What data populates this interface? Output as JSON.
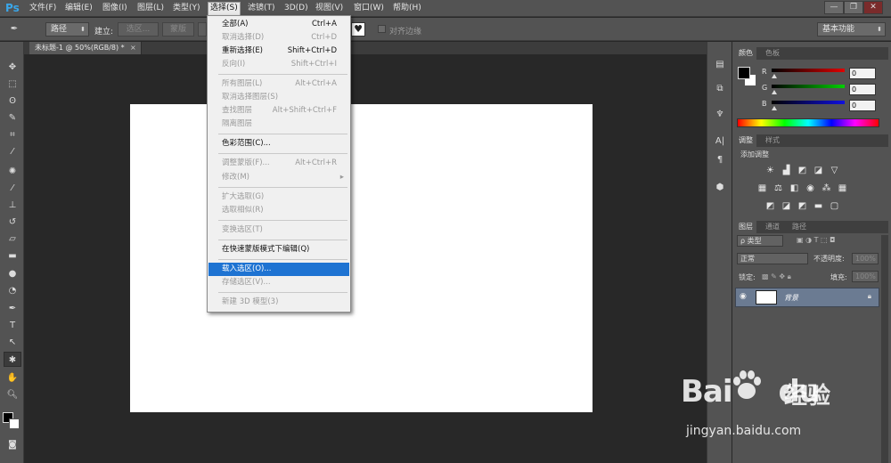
{
  "app": {
    "logo": "Ps"
  },
  "menubar": {
    "items": [
      "文件(F)",
      "编辑(E)",
      "图像(I)",
      "图层(L)",
      "类型(Y)",
      "选择(S)",
      "滤镜(T)",
      "3D(D)",
      "视图(V)",
      "窗口(W)",
      "帮助(H)"
    ],
    "active": "选择(S)"
  },
  "window_buttons": [
    "—",
    "❐",
    "✕"
  ],
  "options": {
    "path_label": "路径",
    "build_label": "建立:",
    "selection_btn": "选区...",
    "mask_btn": "蒙版",
    "align_edges": "对齐边缘",
    "workspace": "基本功能"
  },
  "document_tab": {
    "title": "未标题-1 @ 50%(RGB/8) *",
    "close": "×"
  },
  "select_menu": [
    {
      "label": "全部(A)",
      "shortcut": "Ctrl+A",
      "enabled": true
    },
    {
      "label": "取消选择(D)",
      "shortcut": "Ctrl+D",
      "enabled": false
    },
    {
      "label": "重新选择(E)",
      "shortcut": "Shift+Ctrl+D",
      "enabled": true
    },
    {
      "label": "反向(I)",
      "shortcut": "Shift+Ctrl+I",
      "enabled": false
    },
    {
      "label": "所有图层(L)",
      "shortcut": "Alt+Ctrl+A",
      "enabled": false
    },
    {
      "label": "取消选择图层(S)",
      "shortcut": "",
      "enabled": false
    },
    {
      "label": "查找图层",
      "shortcut": "Alt+Shift+Ctrl+F",
      "enabled": false
    },
    {
      "label": "隔离图层",
      "shortcut": "",
      "enabled": false
    },
    {
      "label": "色彩范围(C)...",
      "shortcut": "",
      "enabled": true
    },
    {
      "label": "调整蒙版(F)...",
      "shortcut": "Alt+Ctrl+R",
      "enabled": false
    },
    {
      "label": "修改(M)",
      "shortcut": "▸",
      "enabled": false
    },
    {
      "label": "扩大选取(G)",
      "shortcut": "",
      "enabled": false
    },
    {
      "label": "选取相似(R)",
      "shortcut": "",
      "enabled": false
    },
    {
      "label": "变换选区(T)",
      "shortcut": "",
      "enabled": false
    },
    {
      "label": "在快速蒙版模式下编辑(Q)",
      "shortcut": "",
      "enabled": true
    },
    {
      "label": "载入选区(O)...",
      "shortcut": "",
      "enabled": true,
      "highlighted": true
    },
    {
      "label": "存储选区(V)...",
      "shortcut": "",
      "enabled": false
    },
    {
      "label": "新建 3D 模型(3)",
      "shortcut": "",
      "enabled": false
    }
  ],
  "color_panel": {
    "tabs": [
      "颜色",
      "色板"
    ],
    "channels": [
      {
        "label": "R",
        "value": "0",
        "color": "#d22020"
      },
      {
        "label": "G",
        "value": "0",
        "color": "#20b020"
      },
      {
        "label": "B",
        "value": "0",
        "color": "#2030d0"
      }
    ]
  },
  "adjust_panel": {
    "tabs": [
      "调整",
      "样式"
    ],
    "heading": "添加调整"
  },
  "layers_panel": {
    "tabs": [
      "图层",
      "通道",
      "路径"
    ],
    "filter": "ρ 类型",
    "blend_mode": "正常",
    "opacity_label": "不透明度:",
    "opacity": "100%",
    "lock_label": "锁定:",
    "fill_label": "填充:",
    "fill": "100%",
    "layer_name": "背景"
  },
  "watermark": {
    "logo_a": "Bai",
    "logo_b": "du",
    "cn": "经验",
    "url": "jingyan.baidu.com"
  }
}
